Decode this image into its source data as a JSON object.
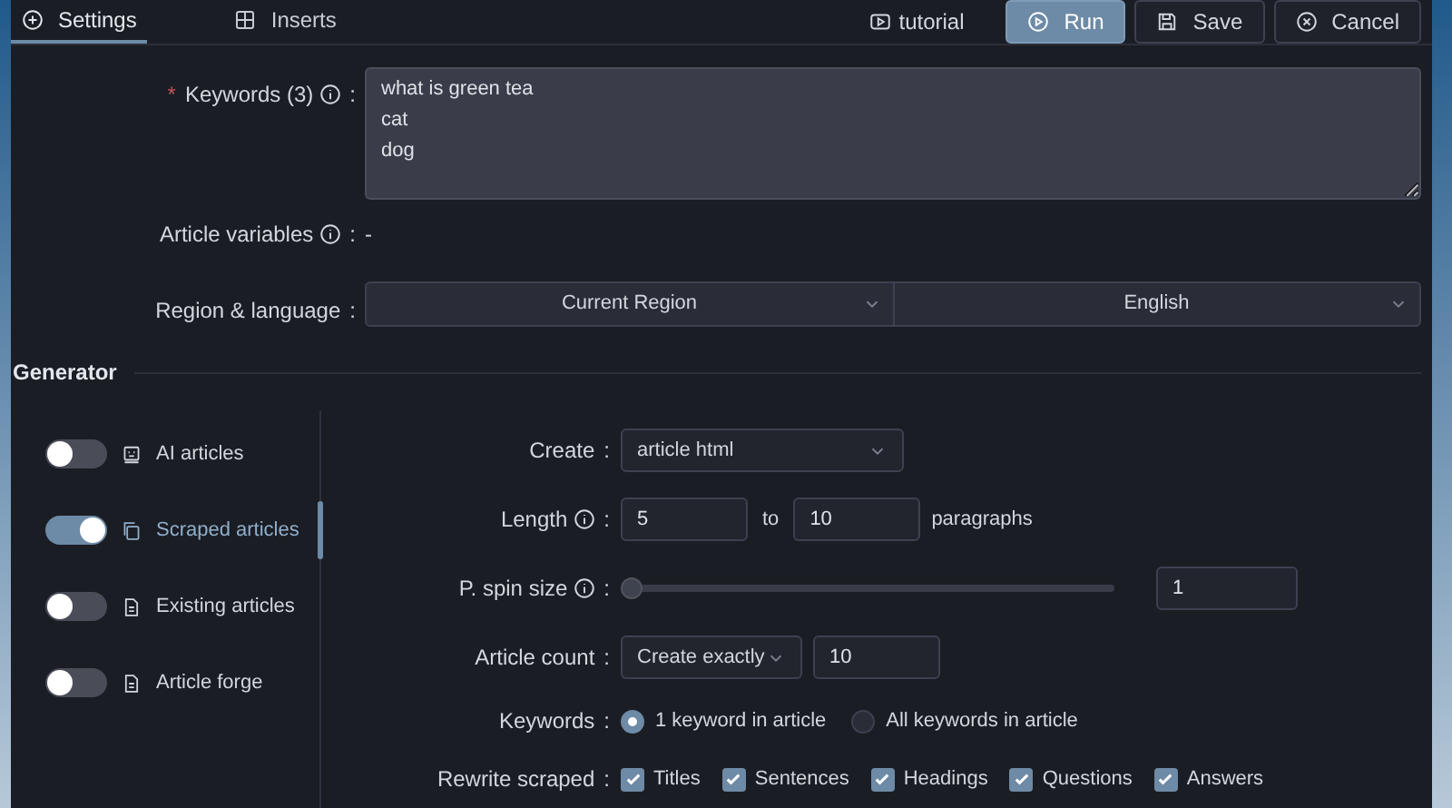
{
  "tabs": [
    {
      "label": "Settings",
      "selected": true
    },
    {
      "label": "Inserts",
      "selected": false
    }
  ],
  "toolbar": {
    "link": "tutorial",
    "buttons": [
      {
        "label": "Run",
        "kind": "primary"
      },
      {
        "label": "Save",
        "kind": "default"
      },
      {
        "label": "Cancel",
        "kind": "default"
      }
    ]
  },
  "keywords": {
    "required_mark": "*",
    "label": "Keywords (3)",
    "info": true,
    "colon": ":",
    "value": "what is green tea\ncat\ndog"
  },
  "article_variables": {
    "label": "Article variables",
    "info": true,
    "colon": ":",
    "value": "-"
  },
  "region_language": {
    "label": "Region & language",
    "colon": ":",
    "region": "Current Region",
    "language": "English"
  },
  "generator": {
    "title": "Generator",
    "sources": [
      {
        "label": "AI articles",
        "on": false,
        "selected": false
      },
      {
        "label": "Scraped articles",
        "on": true,
        "selected": true
      },
      {
        "label": "Existing articles",
        "on": false,
        "selected": false
      },
      {
        "label": "Article forge",
        "on": false,
        "selected": false
      }
    ],
    "create": {
      "label": "Create",
      "colon": ":",
      "value": "article html"
    },
    "length": {
      "label": "Length",
      "info": true,
      "colon": ":",
      "min": "5",
      "to": "to",
      "max": "10",
      "unit": "paragraphs"
    },
    "spin_size": {
      "label": "P. spin size",
      "info": true,
      "colon": ":",
      "level": 0,
      "value": "1"
    },
    "article_count": {
      "label": "Article count",
      "colon": ":",
      "mode": "Create exactly",
      "value": "10"
    },
    "keywords_mode": {
      "label": "Keywords",
      "colon": ":",
      "options": [
        {
          "label": "1 keyword in article",
          "selected": true
        },
        {
          "label": "All keywords in article",
          "selected": false
        }
      ]
    },
    "rewrite_scraped": {
      "label": "Rewrite scraped",
      "colon": ":",
      "options": [
        {
          "label": "Titles",
          "checked": true
        },
        {
          "label": "Sentences",
          "checked": true
        },
        {
          "label": "Headings",
          "checked": true
        },
        {
          "label": "Questions",
          "checked": true
        },
        {
          "label": "Answers",
          "checked": true
        }
      ]
    }
  }
}
